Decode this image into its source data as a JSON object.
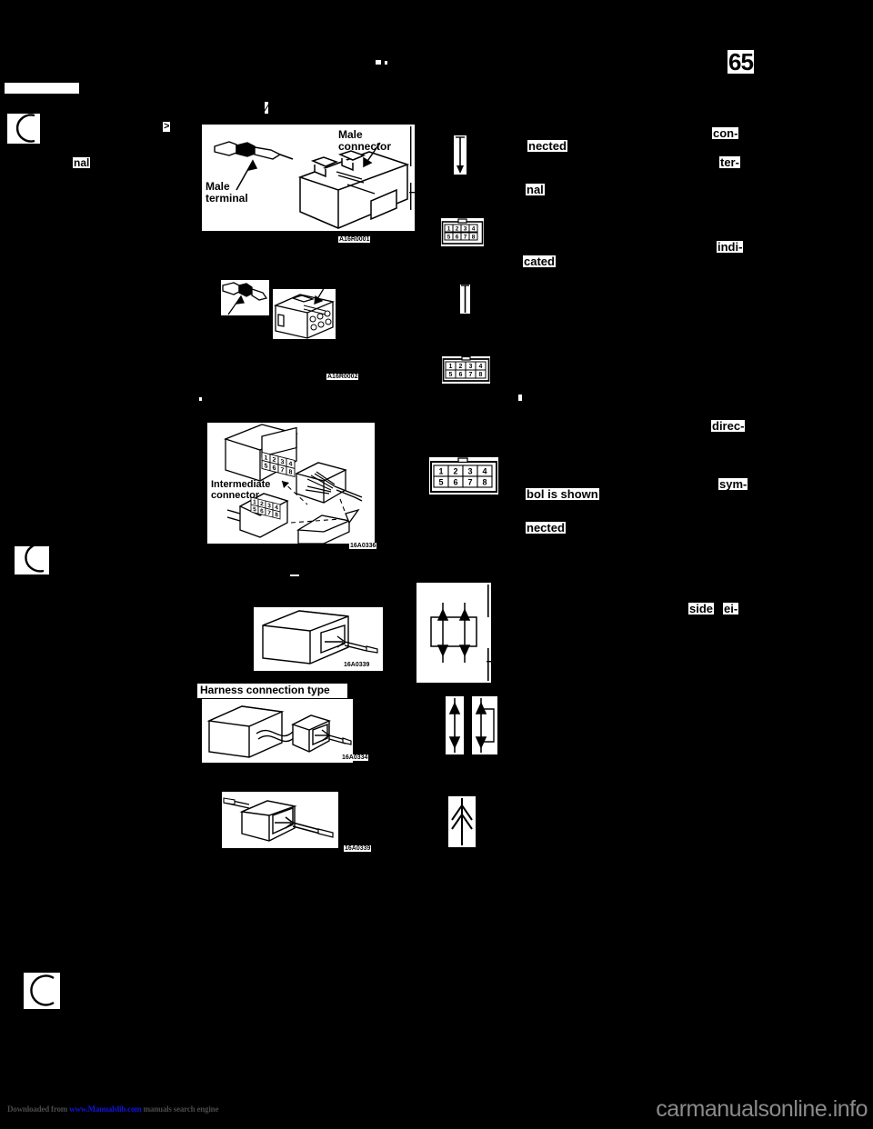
{
  "document": {
    "page_number": "65",
    "type": "scanned-service-manual-page",
    "background_color": "#000000",
    "ink_color": "#ffffff"
  },
  "figures": [
    {
      "id": "fig-male-connector",
      "code": "A16R0001",
      "labels": [
        "Male\nterminal",
        "Male\nconnector"
      ],
      "caption_male_terminal": "Male\nterminal",
      "caption_male_connector": "Male\nconnector"
    },
    {
      "id": "fig-female-connector",
      "code": "A16R0002",
      "labels": []
    },
    {
      "id": "fig-intermediate-connector",
      "code": "16A0336",
      "labels": [
        "Intermediate\nconnector"
      ],
      "caption": "Intermediate\nconnector",
      "pin_numbers_top": [
        "1",
        "2",
        "3",
        "4"
      ],
      "pin_numbers_bottom": [
        "5",
        "6",
        "7",
        "8"
      ]
    },
    {
      "id": "fig-direct-connection",
      "code": "16A0339",
      "labels": []
    },
    {
      "id": "fig-harness-connection",
      "code": "16A0334",
      "caption": "Harness connection type",
      "labels": [
        "Harness connection type"
      ]
    },
    {
      "id": "fig-inline-splice",
      "code": "16A0339",
      "labels": []
    }
  ],
  "symbols": [
    {
      "id": "symbol-down-arrow-long",
      "glyph": "down-arrow"
    },
    {
      "id": "symbol-connector-pins-1",
      "pins_top": [
        "1",
        "2",
        "3",
        "4"
      ],
      "pins_bottom": [
        "5",
        "6",
        "7",
        "8"
      ]
    },
    {
      "id": "symbol-vertical-bar",
      "glyph": "vertical-bar"
    },
    {
      "id": "symbol-connector-pins-2",
      "pins_top": [
        "1",
        "2",
        "3",
        "4"
      ],
      "pins_bottom": [
        "5",
        "6",
        "7",
        "8"
      ]
    },
    {
      "id": "symbol-connector-pins-3",
      "pins_top": [
        "1",
        "2",
        "3",
        "4"
      ],
      "pins_bottom": [
        "5",
        "6",
        "7",
        "8"
      ]
    },
    {
      "id": "symbol-junction-box",
      "glyph": "box-with-four-arrows"
    },
    {
      "id": "symbol-arrow-pair",
      "glyph": "two-arrow-columns"
    },
    {
      "id": "symbol-arrow-single",
      "glyph": "single-up-arrow"
    }
  ],
  "text_fragments": {
    "left": [
      {
        "id": "frag-nal-left",
        "text": "nal"
      }
    ],
    "middle": [
      {
        "id": "frag-nected-1",
        "text": "nected"
      },
      {
        "id": "frag-nal-mid",
        "text": "nal"
      },
      {
        "id": "frag-cated",
        "text": "cated"
      },
      {
        "id": "frag-bol-is-shown",
        "text": "bol is shown"
      },
      {
        "id": "frag-nected-2",
        "text": "nected"
      }
    ],
    "right": [
      {
        "id": "frag-con",
        "text": "con-"
      },
      {
        "id": "frag-ter",
        "text": "ter-"
      },
      {
        "id": "frag-indi",
        "text": "indi-"
      },
      {
        "id": "frag-direc",
        "text": "direc-"
      },
      {
        "id": "frag-sym",
        "text": "sym-"
      },
      {
        "id": "frag-side",
        "text": "side"
      },
      {
        "id": "frag-ei",
        "text": "ei-"
      }
    ]
  },
  "footer": {
    "download_prefix": "Downloaded from ",
    "download_link": "www.Manualslib.com",
    "download_suffix": " manuals search engine",
    "watermark": "carmanualsonline.info"
  }
}
